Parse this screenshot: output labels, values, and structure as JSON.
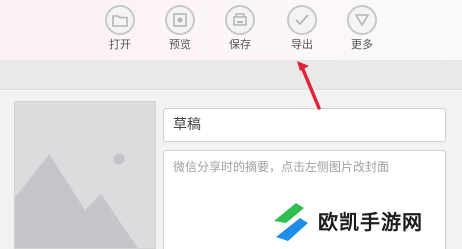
{
  "toolbar": {
    "items": [
      {
        "label": "打开",
        "icon": "folder-icon"
      },
      {
        "label": "预览",
        "icon": "preview-icon"
      },
      {
        "label": "保存",
        "icon": "save-icon"
      },
      {
        "label": "导出",
        "icon": "export-check-icon"
      },
      {
        "label": "更多",
        "icon": "more-triangle-icon"
      }
    ]
  },
  "editor": {
    "title_value": "草稿",
    "summary_placeholder": "微信分享时的摘要，点击左侧图片改封面",
    "cover_icon": "image-placeholder-icon"
  },
  "annotation": {
    "arrow_color": "#e2233a"
  },
  "watermark": {
    "text": "欧凯手游网",
    "logo_colors": [
      "#2fbf4d",
      "#1f8ee8"
    ]
  }
}
